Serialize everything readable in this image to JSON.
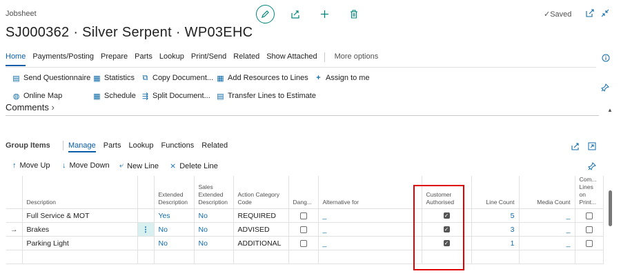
{
  "header": {
    "page_type": "Jobsheet",
    "title": "SJ000362 · Silver Serpent · WP03EHC",
    "status": "Saved",
    "icons": [
      "pencil-icon",
      "share-icon",
      "plus-icon",
      "delete-icon",
      "open-new-icon",
      "collapse-icon"
    ]
  },
  "menu": {
    "items": [
      "Home",
      "Payments/Posting",
      "Prepare",
      "Parts",
      "Lookup",
      "Print/Send",
      "Related",
      "Show Attached"
    ],
    "more": "More options"
  },
  "actions": {
    "send_questionnaire": "Send Questionnaire",
    "statistics": "Statistics",
    "copy_document": "Copy Document...",
    "add_resources": "Add Resources to Lines",
    "assign_to_me": "Assign to me",
    "online_map": "Online Map",
    "schedule": "Schedule",
    "split_document": "Split Document...",
    "transfer_lines": "Transfer Lines to Estimate"
  },
  "comments_label": "Comments",
  "group_items": {
    "title": "Group Items",
    "tabs": [
      "Manage",
      "Parts",
      "Lookup",
      "Functions",
      "Related"
    ],
    "line_actions": {
      "move_up": "Move Up",
      "move_down": "Move Down",
      "new_line": "New Line",
      "delete_line": "Delete Line"
    },
    "columns": {
      "description": "Description",
      "extended_description": "Extended Description",
      "sales_extended_description": "Sales Extended Description",
      "action_category_code": "Action Category Code",
      "dangerous": "Dang...",
      "alternative_for": "Alternative for",
      "customer_authorised": "Customer Authorised",
      "line_count": "Line Count",
      "media_count": "Media Count",
      "comment_lines_on_print": "Com... Lines on Print..."
    },
    "rows": [
      {
        "description": "Full Service & MOT",
        "extended": "Yes",
        "sales_extended": "No",
        "action_category": "REQUIRED",
        "alternative_for": "_",
        "line_count": "5",
        "media_count": "_"
      },
      {
        "description": "Brakes",
        "extended": "No",
        "sales_extended": "No",
        "action_category": "ADVISED",
        "alternative_for": "_",
        "line_count": "3",
        "media_count": "_"
      },
      {
        "description": "Parking Light",
        "extended": "No",
        "sales_extended": "No",
        "action_category": "ADDITIONAL",
        "alternative_for": "_",
        "line_count": "1",
        "media_count": "_"
      }
    ]
  },
  "colors": {
    "accent": "#0a5da8",
    "teal": "#00857a",
    "highlight_box": "#e00000"
  }
}
